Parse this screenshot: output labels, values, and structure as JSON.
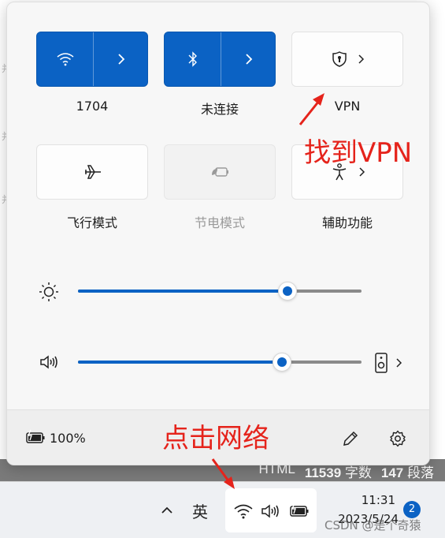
{
  "background": {
    "margin_mark": "并"
  },
  "quick_settings": {
    "tiles": [
      {
        "id": "wifi",
        "label": "1704",
        "state": "on",
        "icon": "wifi-icon",
        "has_expand": true
      },
      {
        "id": "bluetooth",
        "label": "未连接",
        "state": "on",
        "icon": "bluetooth-icon",
        "has_expand": true
      },
      {
        "id": "vpn",
        "label": "VPN",
        "state": "off",
        "icon": "shield-icon",
        "has_expand": true
      },
      {
        "id": "airplane",
        "label": "飞行模式",
        "state": "off",
        "icon": "airplane-icon",
        "has_expand": false
      },
      {
        "id": "battery-saver",
        "label": "节电模式",
        "state": "disabled",
        "icon": "battery-saver-icon",
        "has_expand": false
      },
      {
        "id": "accessibility",
        "label": "辅助功能",
        "state": "off",
        "icon": "accessibility-icon",
        "has_expand": true
      }
    ],
    "brightness": {
      "icon": "sun-icon",
      "level_fraction": 0.74
    },
    "volume": {
      "icon": "speaker-icon",
      "level_fraction": 0.72,
      "output_icon": "audio-output-device-icon"
    },
    "footer": {
      "battery_percent": "100%",
      "battery_icon": "battery-charging-icon",
      "edit_icon": "pencil-icon",
      "settings_icon": "gear-icon"
    }
  },
  "status_bar": {
    "format": "HTML",
    "char_count": "11539",
    "char_unit": "字数",
    "para_count": "147",
    "para_unit": "段落"
  },
  "taskbar": {
    "chevron": "^",
    "ime": "英",
    "tray_icons": [
      "wifi-icon",
      "speaker-icon",
      "battery-charging-icon"
    ],
    "time": "11:31",
    "date": "2023/5/24",
    "notification_count": "2",
    "watermark": "CSDN @是个奇猿"
  },
  "annotations": {
    "find_vpn": "找到VPN",
    "click_network": "点击网络"
  },
  "colors": {
    "accent": "#0b62c4",
    "annotation": "#e5231b"
  }
}
